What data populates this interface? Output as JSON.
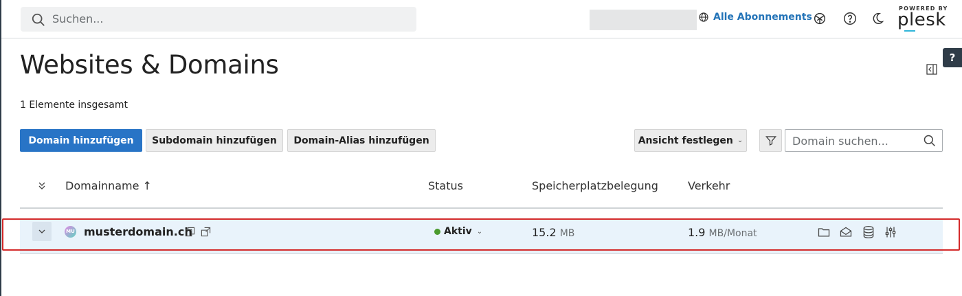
{
  "header": {
    "search_placeholder": "Suchen...",
    "subscriptions_label": "Alle Abonnements",
    "powered_by": "POWERED BY",
    "brand": "plesk"
  },
  "page": {
    "help_label": "?",
    "title": "Websites & Domains",
    "item_count": "1 Elemente insgesamt"
  },
  "toolbar": {
    "add_domain": "Domain hinzufügen",
    "add_subdomain": "Subdomain hinzufügen",
    "add_alias": "Domain-Alias hinzufügen",
    "view_label": "Ansicht festlegen",
    "domain_search_placeholder": "Domain suchen..."
  },
  "table": {
    "columns": {
      "name": "Domainname ↑",
      "status": "Status",
      "disk": "Speicherplatzbelegung",
      "traffic": "Verkehr"
    },
    "rows": [
      {
        "avatar": "MU",
        "domain": "musterdomain.ch",
        "status": "Aktiv",
        "disk_value": "15.2",
        "disk_unit": "MB",
        "traffic_value": "1.9",
        "traffic_unit": "MB/Monat"
      }
    ]
  },
  "colors": {
    "primary": "#2874c6",
    "link": "#2474b8",
    "status_active": "#4b9b2f",
    "highlight": "#d42b2b"
  },
  "icons": [
    "search-icon",
    "globe-icon",
    "extensions-icon",
    "help-icon",
    "dark-mode-icon",
    "panel-toggle-icon",
    "filter-icon",
    "expand-all-icon",
    "chevron-down-icon",
    "copy-icon",
    "open-external-icon",
    "folder-icon",
    "mail-icon",
    "database-icon",
    "settings-sliders-icon"
  ]
}
